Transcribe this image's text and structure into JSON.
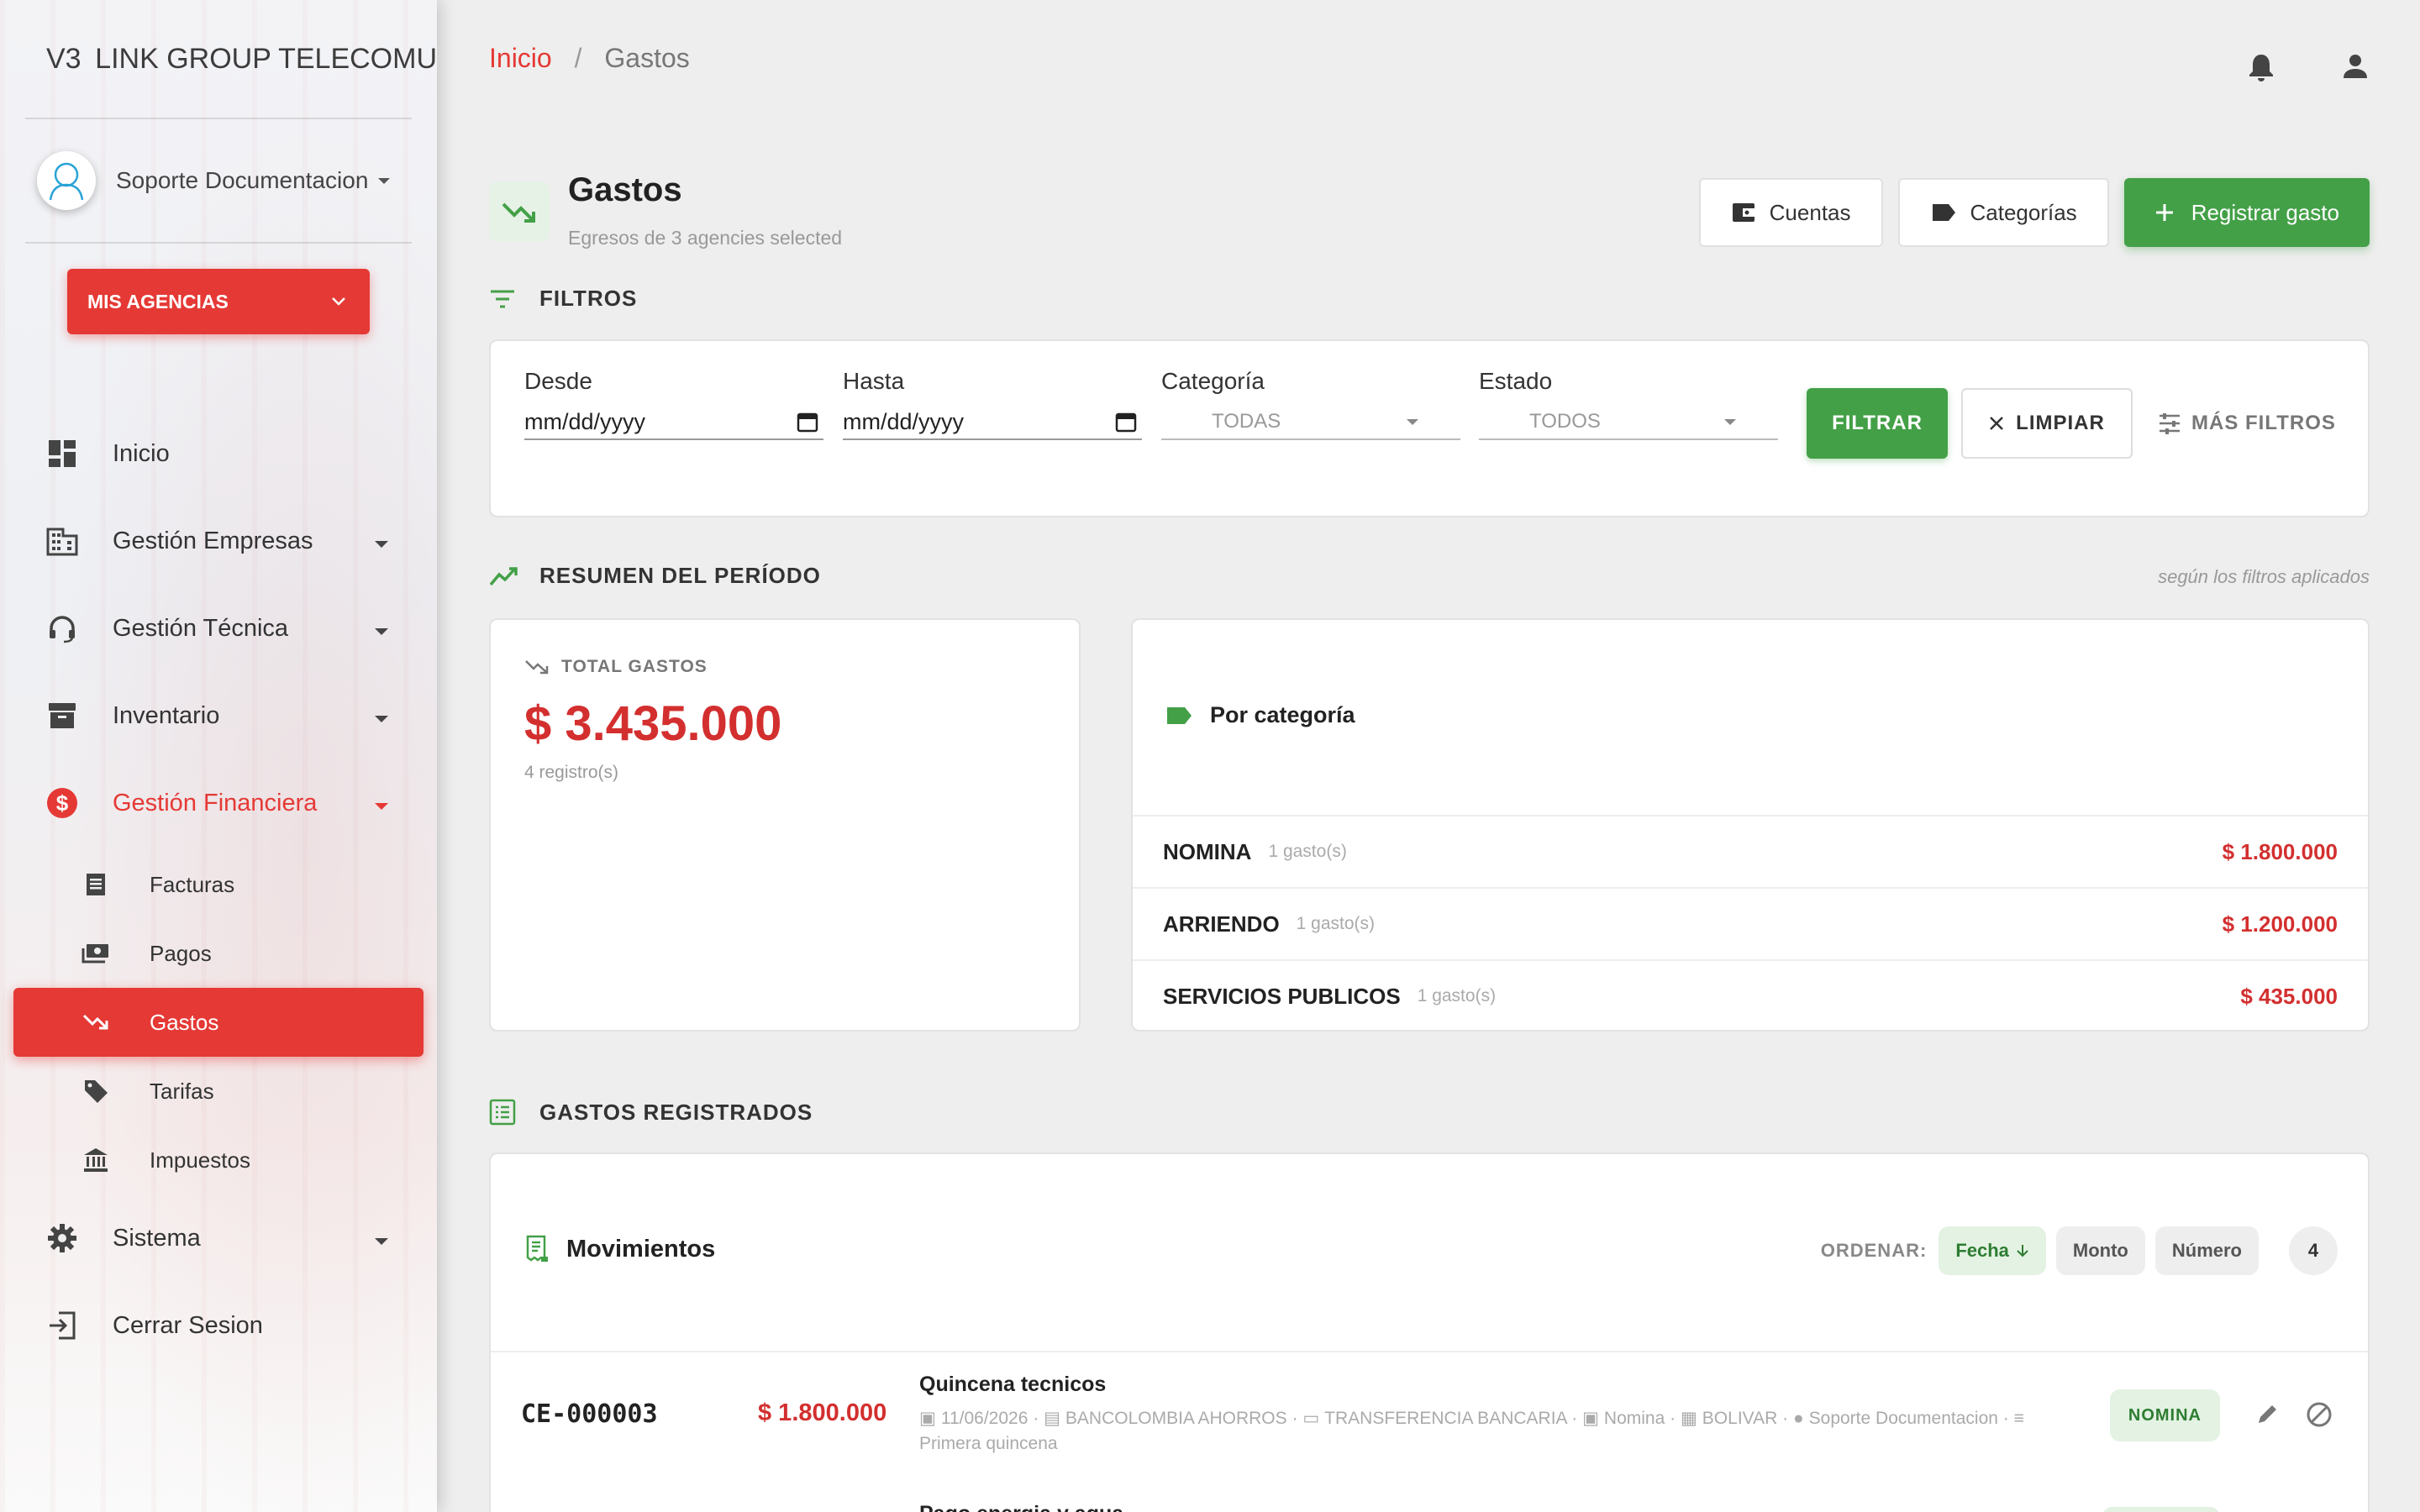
{
  "sidebar": {
    "brand_mini": "V3",
    "brand_name": "LINK GROUP TELECOMU",
    "user_name": "Soporte Documentacion",
    "agency_button": "MIS AGENCIAS",
    "items": [
      {
        "label": "Inicio",
        "icon": "dashboard-icon"
      },
      {
        "label": "Gestión Empresas",
        "icon": "building-icon"
      },
      {
        "label": "Gestión Técnica",
        "icon": "headset-icon"
      },
      {
        "label": "Inventario",
        "icon": "archive-icon"
      },
      {
        "label": "Gestión Financiera",
        "icon": "dollar-circle-icon"
      },
      {
        "label": "Sistema",
        "icon": "gear-icon"
      },
      {
        "label": "Cerrar Sesion",
        "icon": "logout-icon"
      }
    ],
    "sub_items": [
      {
        "label": "Facturas",
        "icon": "receipt-icon"
      },
      {
        "label": "Pagos",
        "icon": "cash-icon"
      },
      {
        "label": "Gastos",
        "icon": "trending-down-icon"
      },
      {
        "label": "Tarifas",
        "icon": "tag-icon"
      },
      {
        "label": "Impuestos",
        "icon": "bank-icon"
      }
    ],
    "active_color": "#e53935"
  },
  "breadcrumb": {
    "home": "Inicio",
    "separator": "/",
    "current": "Gastos"
  },
  "header": {
    "title": "Gastos",
    "subtitle": "Egresos de 3 agencies selected",
    "btn_accounts": "Cuentas",
    "btn_categories": "Categorías",
    "btn_register": "Registrar gasto"
  },
  "filters": {
    "section_title": "FILTROS",
    "from_label": "Desde",
    "from_value": "mm/dd/yyyy",
    "to_label": "Hasta",
    "to_value": "mm/dd/yyyy",
    "category_label": "Categoría",
    "category_value": "TODAS",
    "status_label": "Estado",
    "status_value": "TODOS",
    "btn_filter": "FILTRAR",
    "btn_clear": "LIMPIAR",
    "btn_more": "MÁS FILTROS"
  },
  "summary": {
    "section_title": "RESUMEN DEL PERÍODO",
    "note": "según los filtros aplicados",
    "total_label": "TOTAL GASTOS",
    "total_value": "$ 3.435.000",
    "total_count": "4 registro(s)",
    "by_category_title": "Por categoría",
    "categories": [
      {
        "name": "NOMINA",
        "count": "1 gasto(s)",
        "amount": "$ 1.800.000"
      },
      {
        "name": "ARRIENDO",
        "count": "1 gasto(s)",
        "amount": "$ 1.200.000"
      },
      {
        "name": "SERVICIOS PUBLICOS",
        "count": "1 gasto(s)",
        "amount": "$ 435.000"
      }
    ]
  },
  "records": {
    "section_title": "GASTOS REGISTRADOS",
    "card_title": "Movimientos",
    "order_label": "ORDENAR:",
    "order_options": [
      "Fecha",
      "Monto",
      "Número"
    ],
    "count": "4",
    "rows": [
      {
        "number": "CE-000003",
        "amount": "$ 1.800.000",
        "description": "Quincena tecnicos",
        "date": "11/06/2026",
        "account": "BANCOLOMBIA AHORROS",
        "method": "TRANSFERENCIA BANCARIA",
        "category": "Nomina",
        "agency": "BOLIVAR",
        "user": "Soporte Documentacion",
        "note": "Primera quincena",
        "badge": "NOMINA"
      },
      {
        "description": "Pago energia y agua"
      }
    ]
  },
  "colors": {
    "green": "#43a047",
    "red": "#d32f2f"
  }
}
